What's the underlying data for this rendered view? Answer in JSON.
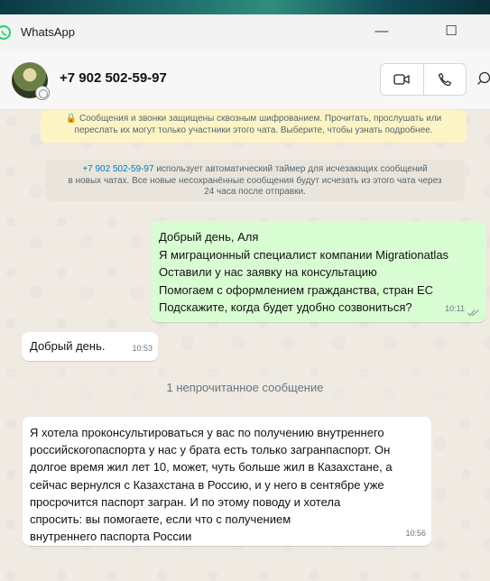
{
  "window": {
    "title": "WhatsApp",
    "minimize_glyph": "—",
    "maximize_glyph": "☐",
    "icons": [
      "whatsapp-logo-icon",
      "minimize-icon",
      "maximize-icon"
    ]
  },
  "header": {
    "contact_name": "+7 902 502-59-97",
    "icons": [
      "avatar",
      "status-ring-icon",
      "video-call-icon",
      "phone-icon",
      "search-icon"
    ]
  },
  "notices": {
    "encryption": {
      "line1": "🔒 Сообщения и звонки защищены сквозным шифрованием. Прочитать, прослушать или",
      "line2": "переслать их могут только участники этого чата. Выберите, чтобы узнать подробнее."
    },
    "timer": {
      "phone": "+7 902 502-59-97",
      "line1_rest": " использует автоматический таймер для исчезающих сообщений",
      "line2": "в новых чатах. Все новые несохранённые сообщения будут исчезать из этого чата через",
      "line3": "24 часа после отправки."
    }
  },
  "messages": {
    "outgoing_1": {
      "lines": [
        "Добрый день, Аля",
        "Я миграционный специалист компании Migrationatlas",
        "Оставили у нас заявку на консультацию",
        "Помогаем с оформлением гражданства, стран ЕС",
        "Подскажите, когда будет удобно созвониться?"
      ],
      "time": "10:11",
      "status_icon": "double-check-icon"
    },
    "incoming_1": {
      "text": "Добрый день.",
      "time": "10:53"
    },
    "unread_divider": "1 непрочитанное сообщение",
    "incoming_2": {
      "lines": [
        "Я хотела проконсультироваться у вас по получению внутреннего",
        "российскогопаспорта у нас у брата есть только загранпаспорт. Он",
        "долгое время жил лет 10, может, чуть больше жил в Казахстане, а",
        "сейчас вернулся с Казахстана в Россию, и у него в сентябре уже",
        "просрочится паспорт загран. И по этому поводу и хотела",
        "спросить: вы помогаете, если что с получением",
        "внутреннего паспорта России"
      ],
      "time": "10:56"
    }
  },
  "colors": {
    "outgoing_bubble": "#d9fdd3",
    "incoming_bubble": "#ffffff",
    "chat_background": "#efeae2",
    "encryption_notice": "#fdf4c5",
    "link": "#027eb5",
    "read_checks": "#8696a0"
  }
}
